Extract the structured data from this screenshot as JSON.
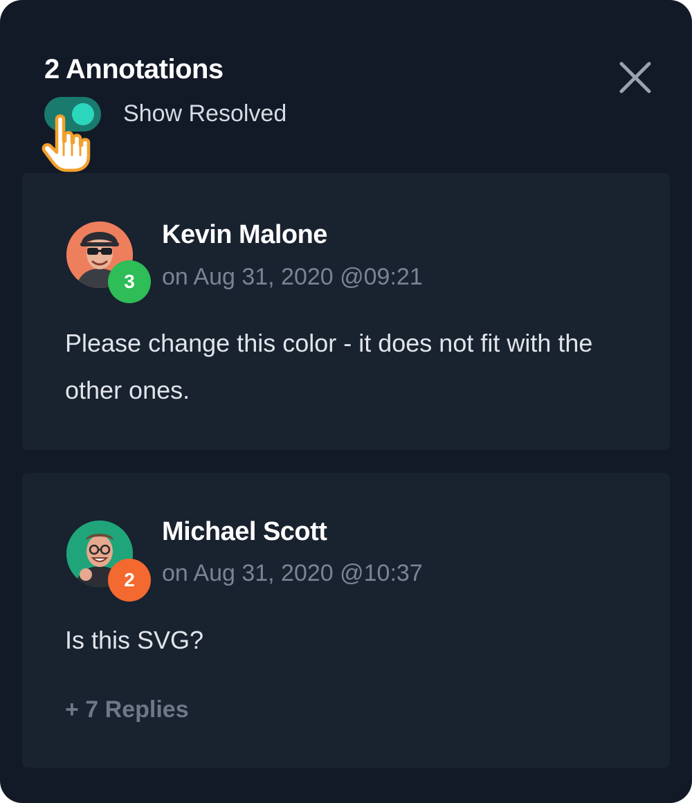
{
  "header": {
    "title": "2 Annotations",
    "close_icon": "close-icon"
  },
  "toggle": {
    "label": "Show Resolved",
    "state": "on",
    "track_color": "#1b7a6e",
    "knob_color": "#2bd6bd"
  },
  "cursor_icon": "hand-pointer-icon",
  "annotations": [
    {
      "author": "Kevin Malone",
      "date": "on Aug 31, 2020 @09:21",
      "badge": "3",
      "badge_color": "#2ebd57",
      "avatar_bg": "#ee7f5c",
      "message": "Please change this color - it does not fit with the other ones."
    },
    {
      "author": "Michael Scott",
      "date": "on Aug 31, 2020 @10:37",
      "badge": "2",
      "badge_color": "#f4692f",
      "avatar_bg": "#1fa579",
      "message": "Is this SVG?",
      "replies": "+ 7 Replies"
    }
  ],
  "colors": {
    "panel_bg": "#131a27",
    "card_bg": "#19222f"
  }
}
